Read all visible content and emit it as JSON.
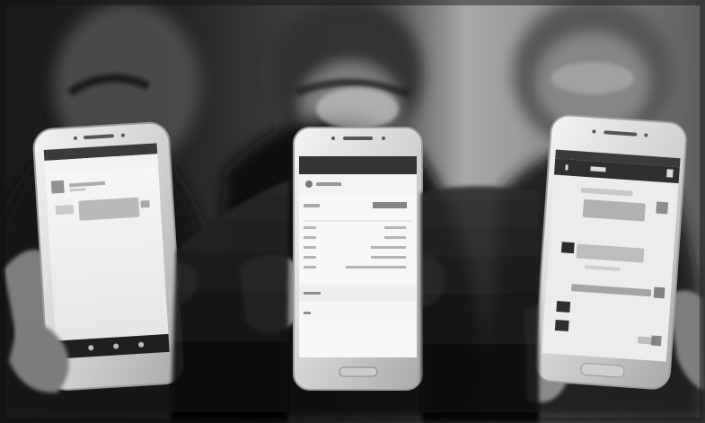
{
  "scene": {
    "description_tag": "photo",
    "palette": {
      "background_dark": "#141414",
      "wall_light": "#bdbdbd",
      "phone_body": "#d8d8d8",
      "screen_white": "#f2f2f2",
      "chat_bg": "#e4e4e4",
      "bubble_gray": "#b0b0b0",
      "ui_dark_bar": "#3a3a3a",
      "skin": "#8e8e8e"
    }
  },
  "phones": {
    "left": {
      "screen": "chat-app",
      "label": ""
    },
    "center": {
      "screen": "order-details",
      "label": ""
    },
    "right": {
      "screen": "chat-app",
      "label": ""
    }
  }
}
